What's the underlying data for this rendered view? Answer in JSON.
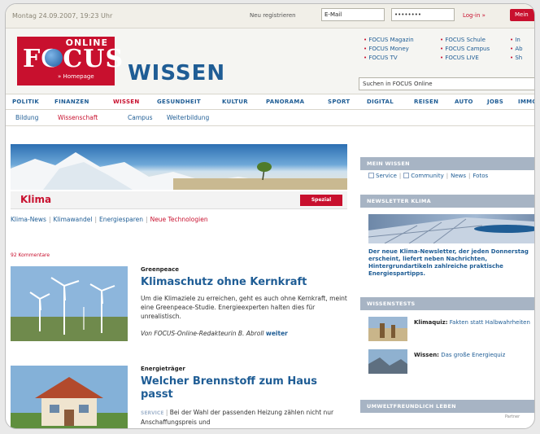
{
  "topbar": {
    "date": "Montag 24.09.2007, 19:23 Uhr",
    "register": "Neu registrieren",
    "email_value": "E-Mail",
    "password_value": "••••••••",
    "login": "Log-in »",
    "mein_focus": "Mein"
  },
  "header": {
    "logo_online": "ONLINE",
    "logo_focus": "FOCUS",
    "logo_homepage": "» Homepage",
    "section_title": "WISSEN",
    "promos": [
      "FOCUS Magazin",
      "FOCUS Money",
      "FOCUS TV",
      "FOCUS Schule",
      "FOCUS Campus",
      "FOCUS LIVE",
      "In",
      "Ab",
      "Sh"
    ],
    "search_placeholder": "Suchen in FOCUS Online"
  },
  "nav": {
    "items": [
      "POLITIK",
      "FINANZEN",
      "WISSEN",
      "GESUNDHEIT",
      "KULTUR",
      "PANORAMA",
      "SPORT",
      "DIGITAL",
      "REISEN",
      "AUTO",
      "JOBS",
      "IMMO"
    ],
    "active": "WISSEN"
  },
  "subnav": {
    "items": [
      "Bildung",
      "Wissenschaft",
      "Campus",
      "Weiterbildung"
    ],
    "active": "Wissenschaft"
  },
  "klima": {
    "title": "Klima",
    "badge": "Spezial",
    "links": [
      "Klima-News",
      "Klimawandel",
      "Energiesparen",
      "Neue Technologien"
    ],
    "comments": "92 Kommentare"
  },
  "articles": [
    {
      "kicker": "Greenpeace",
      "headline": "Klimaschutz ohne Kernkraft",
      "teaser": "Um die Klimaziele zu erreichen, geht es auch ohne Kernkraft, meint eine Greenpeace-Studie. Energieexperten halten dies für unrealistisch.",
      "byline": "Von FOCUS-Online-Redakteurin B. Abroll",
      "more": "weiter"
    },
    {
      "kicker": "Energieträger",
      "headline": "Welcher Brennstoff zum Haus passt",
      "service": "SERVICE",
      "teaser": "Bei der Wahl der passenden Heizung zählen nicht nur Anschaffungspreis und"
    }
  ],
  "sidebar": {
    "mein_wissen": {
      "title": "MEIN WISSEN",
      "links": [
        "Service",
        "Community",
        "News",
        "Fotos"
      ]
    },
    "newsletter": {
      "title": "NEWSLETTER KLIMA",
      "text": "Der neue Klima-Newsletter, der jeden Donnerstag erscheint, liefert neben Nachrichten, Hintergrundartikeln zahlreiche praktische Energiespartipps."
    },
    "tests": {
      "title": "WISSENSTESTS",
      "items": [
        {
          "label": "Klimaquiz:",
          "text": "Fakten statt Halbwahrheiten"
        },
        {
          "label": "Wissen:",
          "text": "Das große Energiequiz"
        }
      ]
    },
    "umwelt": {
      "title": "UMWELTFREUNDLICH LEBEN",
      "partner": "Partner"
    }
  },
  "colors": {
    "brand_red": "#c8102e",
    "link_blue": "#1f5d95",
    "sidebar_head": "#a7b4c4"
  }
}
